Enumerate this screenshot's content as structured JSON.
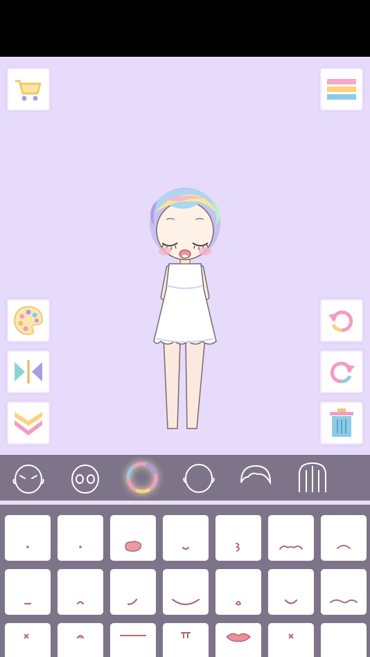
{
  "colors": {
    "background": "#e7dbfb",
    "tab_bar": "#7d7489",
    "mouth_stroke": "#b06a6a",
    "accent_pink": "#f49bc2",
    "accent_yellow": "#fbd27a",
    "accent_blue": "#8ecbe8"
  },
  "left_tools": [
    {
      "icon": "shopping-cart-icon"
    },
    {
      "icon": "palette-icon"
    },
    {
      "icon": "mirror-flip-icon"
    },
    {
      "icon": "chevron-double-down-icon"
    }
  ],
  "right_tools": [
    {
      "icon": "menu-icon"
    },
    {
      "icon": "undo-icon"
    },
    {
      "icon": "redo-icon"
    },
    {
      "icon": "trash-icon"
    }
  ],
  "category_tabs": [
    {
      "icon": "face-icon",
      "selected": false
    },
    {
      "icon": "eyes-icon",
      "selected": false
    },
    {
      "icon": "mouth-ring-icon",
      "selected": true
    },
    {
      "icon": "head-shape-icon",
      "selected": false
    },
    {
      "icon": "bangs-icon",
      "selected": false
    },
    {
      "icon": "hair-icon",
      "selected": false
    },
    {
      "icon": "back-hair-icon",
      "selected": false
    }
  ],
  "mouth_options": [
    "dot-small",
    "dot-small",
    "open-pink",
    "smile-small",
    "curly",
    "wide-frown",
    "frown-arc",
    "dash",
    "caret",
    "smirk",
    "wide-smile",
    "oval",
    "v-small",
    "wavy",
    "x-mark",
    "tongue",
    "flat-line",
    "stand",
    "heart-lips",
    "x-small",
    "plain"
  ]
}
